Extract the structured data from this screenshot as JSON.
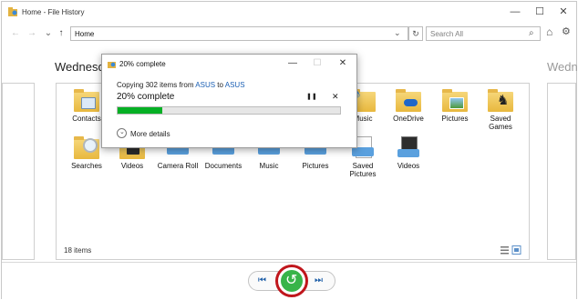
{
  "window": {
    "title": "Home - File History",
    "minimize_glyph": "—",
    "maximize_glyph": "☐",
    "close_glyph": "✕"
  },
  "toolbar": {
    "back_glyph": "←",
    "forward_glyph": "→",
    "up_glyph": "↑",
    "address_value": "Home",
    "dropdown_glyph": "⌄",
    "refresh_glyph": "↻",
    "search_placeholder": "Search All",
    "search_glyph": "⌕",
    "home_glyph": "⌂",
    "settings_glyph": "⚙"
  },
  "timeline": {
    "current_day": "Wednesda",
    "next_day": "Wedn"
  },
  "items": [
    {
      "label": "Contacts",
      "icon": "contacts-folder-icon"
    },
    {
      "label": "",
      "icon": "folder-icon"
    },
    {
      "label": "",
      "icon": "folder-icon"
    },
    {
      "label": "",
      "icon": "folder-icon"
    },
    {
      "label": "",
      "icon": "folder-icon"
    },
    {
      "label": "",
      "icon": "folder-icon"
    },
    {
      "label": "Music",
      "icon": "music-folder-icon"
    },
    {
      "label": "OneDrive",
      "icon": "onedrive-folder-icon"
    },
    {
      "label": "Pictures",
      "icon": "pictures-folder-icon"
    },
    {
      "label": "Saved Games",
      "icon": "saved-games-folder-icon"
    },
    {
      "label": "Searches",
      "icon": "searches-folder-icon"
    },
    {
      "label": "Videos",
      "icon": "videos-folder-icon"
    },
    {
      "label": "Camera Roll",
      "icon": "library-icon"
    },
    {
      "label": "Documents",
      "icon": "library-icon"
    },
    {
      "label": "Music",
      "icon": "library-icon"
    },
    {
      "label": "Pictures",
      "icon": "library-icon"
    },
    {
      "label": "Saved Pictures",
      "icon": "library-icon"
    },
    {
      "label": "Videos",
      "icon": "videos-library-icon"
    }
  ],
  "status": {
    "item_count": "18 items"
  },
  "playback": {
    "previous_glyph": "⏮",
    "next_glyph": "⏭",
    "restore_glyph": "↺"
  },
  "dialog": {
    "title": "20% complete",
    "copying_prefix": "Copying 302 items from ",
    "source": "ASUS",
    "copying_mid": " to ",
    "destination": "ASUS",
    "percent_text": "20% complete",
    "progress": 0.2,
    "pause_glyph": "❚❚",
    "cancel_glyph": "✕",
    "more_details": "More details",
    "minimize_glyph": "—",
    "maximize_glyph": "☐",
    "close_glyph": "✕"
  },
  "colors": {
    "progress_fill": "#06b025",
    "link": "#1a5fb4",
    "restore_button": "#38b449",
    "highlight_ring": "#c0161c",
    "folder": "#f0c65a"
  }
}
